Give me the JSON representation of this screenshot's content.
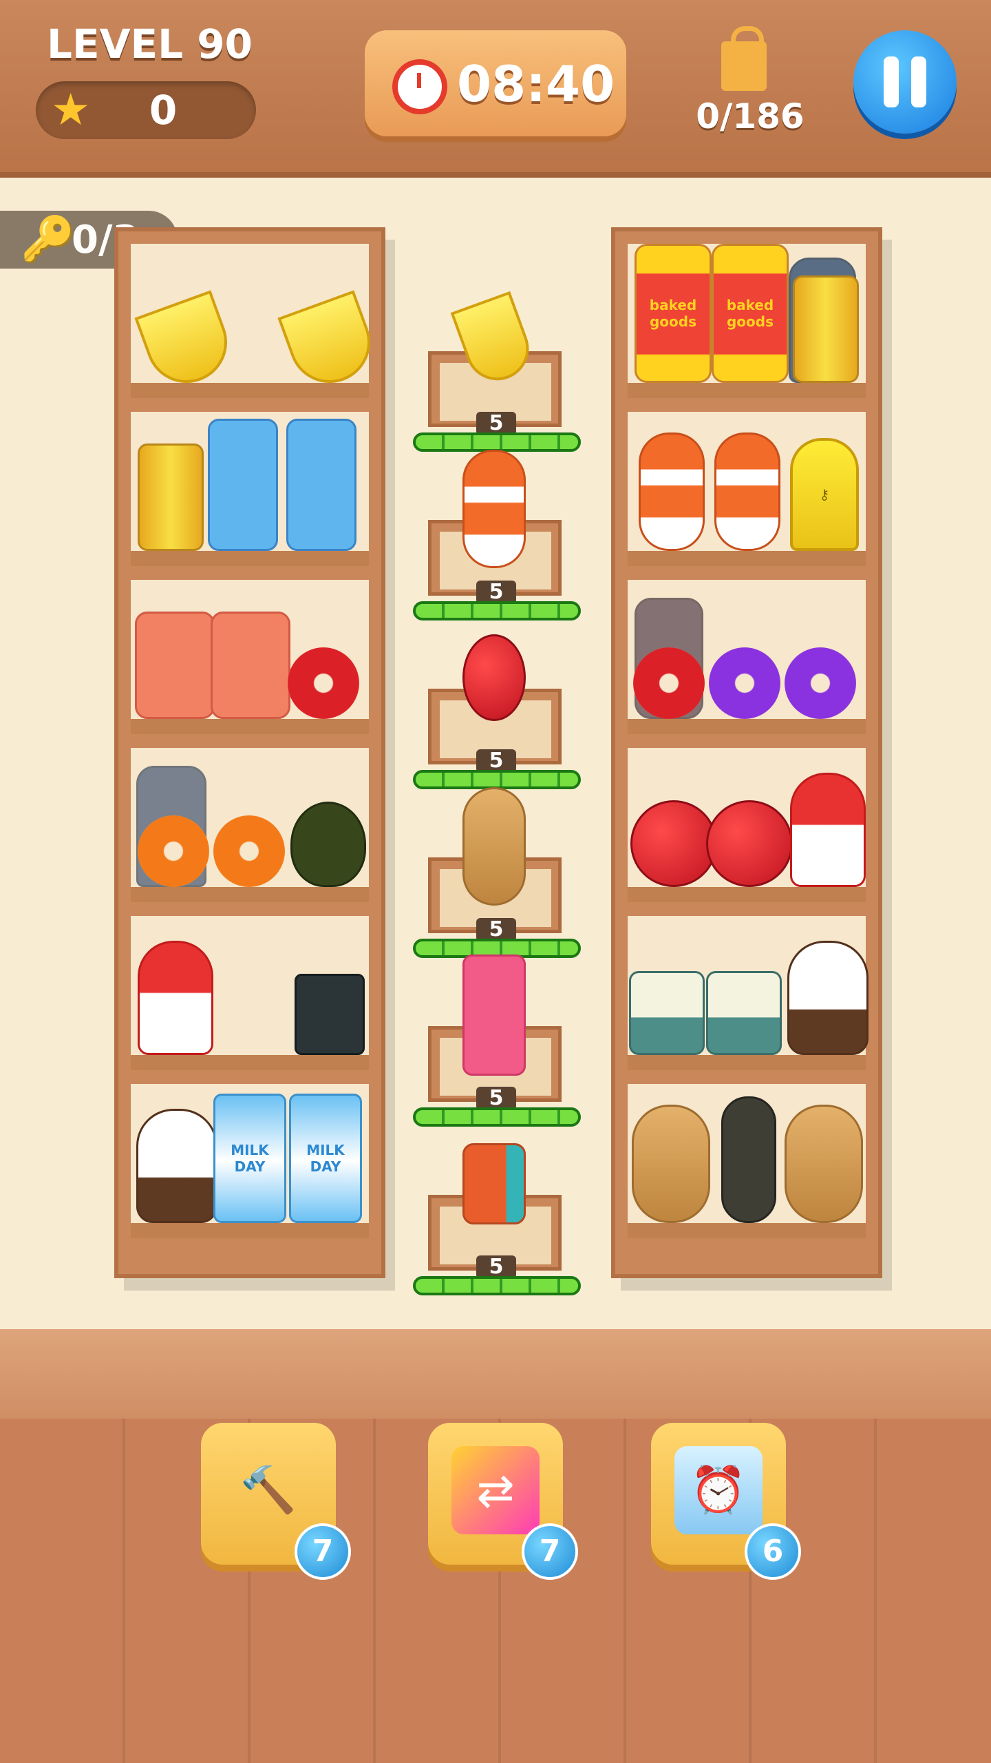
{
  "hud": {
    "level_label": "LEVEL 90",
    "stars": "0",
    "timer": "08:40",
    "bag_progress": "0/186",
    "keys_progress": "0/3"
  },
  "shelves": {
    "left_column": [
      [
        "banana",
        "banana"
      ],
      [
        "juice-can",
        "milk-carton",
        "milk-carton"
      ],
      [
        "candle",
        "candle",
        "red-donut"
      ],
      [
        "orange-donut",
        "orange-donut",
        "pear"
      ],
      [
        "mushroom",
        "",
        "mug"
      ],
      [
        "panda-plush",
        "milk-day",
        "milk-day"
      ]
    ],
    "middle_column": [
      {
        "item": "banana",
        "count": "5",
        "progress": 1.0
      },
      {
        "item": "skewer",
        "count": "5",
        "progress": 1.0
      },
      {
        "item": "cherry",
        "count": "5",
        "progress": 1.0
      },
      {
        "item": "potato",
        "count": "5",
        "progress": 1.0
      },
      {
        "item": "chips-bag",
        "count": "5",
        "progress": 1.0
      },
      {
        "item": "toy-train",
        "count": "5",
        "progress": 1.0
      }
    ],
    "right_column": [
      [
        "baked-goods",
        "baked-goods",
        "juice-can"
      ],
      [
        "skewer",
        "skewer",
        "key"
      ],
      [
        "red-donut",
        "purple-donut",
        "purple-donut"
      ],
      [
        "cherry",
        "cherry",
        "mushroom"
      ],
      [
        "teal-mug",
        "teal-mug",
        "panda-plush"
      ],
      [
        "potato",
        "carrot",
        "potato"
      ]
    ]
  },
  "item_labels": {
    "milk_day": "MILK DAY",
    "baked_goods": "baked goods"
  },
  "powerups": [
    {
      "name": "hammer",
      "count": "7"
    },
    {
      "name": "shuffle",
      "count": "7"
    },
    {
      "name": "freeze-time",
      "count": "6"
    }
  ]
}
